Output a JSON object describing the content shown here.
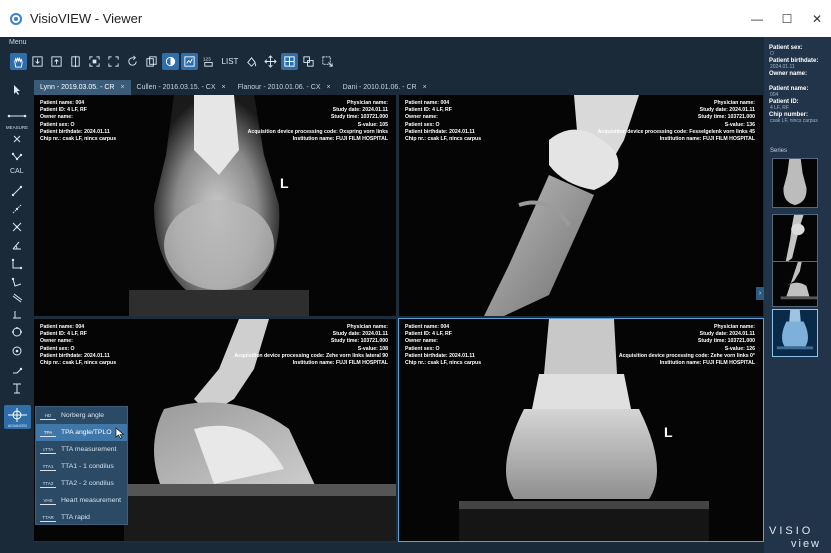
{
  "window": {
    "title": "VisioVIEW - Viewer",
    "minimize": "—",
    "maximize": "☐",
    "close": "✕"
  },
  "menu_label": "Menu",
  "toolbar": {
    "list_label": "LIST"
  },
  "left_tools": {
    "measure_label": "MEASURE",
    "cal_label": "CAL",
    "advanced_label": "ADVANCED"
  },
  "tabs": [
    {
      "label": "Lynn - 2019.03.05. - CR",
      "close": "×"
    },
    {
      "label": "Cullen - 2016.03.15. - CX",
      "close": "×"
    },
    {
      "label": "Flanour - 2010.01.06. - CX",
      "close": "×"
    },
    {
      "label": "Dani - 2010.01.06. - CR",
      "close": "×"
    }
  ],
  "viewports": [
    {
      "left": [
        "Patient name: 004",
        "Patient ID: 4 LF, RF",
        "Owner name:",
        "Patient sex: O",
        "Patient birthdate: 2024.01.11",
        "Chip nr.: csak LF, nincs carpus"
      ],
      "right": [
        "Physician name:",
        "Study date: 2024.01.11",
        "Study time: 103721.000",
        "S-value: 105",
        "Acquisition device processing code: Oxspring vorn links",
        "Institution name: FUJI FILM HOSPITAL"
      ],
      "marker": "L"
    },
    {
      "left": [
        "Patient name: 004",
        "Patient ID: 4 LF, RF",
        "Owner name:",
        "Patient sex: O",
        "Patient birthdate: 2024.01.11",
        "Chip nr.: csak LF, nincs carpus"
      ],
      "right": [
        "Physician name:",
        "Study date: 2024.01.11",
        "Study time: 103721.000",
        "S-value: 136",
        "Acquisition device processing code: Fesselgelenk vorn links 45",
        "Institution name: FUJI FILM HOSPITAL"
      ],
      "marker": ""
    },
    {
      "left": [
        "Patient name: 004",
        "Patient ID: 4 LF, RF",
        "Owner name:",
        "Patient sex: O",
        "Patient birthdate: 2024.01.11",
        "Chip nr.: csak LF, nincs carpus"
      ],
      "right": [
        "Physician name:",
        "Study date: 2024.01.11",
        "Study time: 103721.000",
        "S-value: 108",
        "Acquisition device processing code: Zehe vorn links lateral 90",
        "Institution name: FUJI FILM HOSPITAL"
      ],
      "marker": ""
    },
    {
      "left": [
        "Patient name: 004",
        "Patient ID: 4 LF, RF",
        "Owner name:",
        "Patient sex: O",
        "Patient birthdate: 2024.01.11",
        "Chip nr.: csak LF, nincs carpus"
      ],
      "right": [
        "Physician name:",
        "Study date: 2024.01.11",
        "Study time: 103721.000",
        "S-value: 126",
        "Acquisition device processing code: Zehe vorn links 0°",
        "Institution name: FUJI FILM HOSPITAL"
      ],
      "marker": "L"
    }
  ],
  "dropdown": [
    {
      "code": "HD",
      "label": "Norberg angle"
    },
    {
      "code": "TPA",
      "label": "TPA angle/TPLO"
    },
    {
      "code": "cTTA",
      "label": "TTA measurement"
    },
    {
      "code": "TTA1",
      "label": "TTA1 - 1 condilus"
    },
    {
      "code": "TTA2",
      "label": "TTA2 - 2 condilus"
    },
    {
      "code": "VHS",
      "label": "Heart measurement"
    },
    {
      "code": "TTAR",
      "label": "TTA rapid"
    }
  ],
  "right_panel": {
    "fields": [
      {
        "label": "Patient sex:",
        "value": "O"
      },
      {
        "label": "Patient birthdate:",
        "value": "2024.01.11"
      },
      {
        "label": "Owner name:",
        "value": ""
      },
      {
        "label": "Patient name:",
        "value": "004"
      },
      {
        "label": "Patient ID:",
        "value": "4 LF, RF"
      },
      {
        "label": "Chip number:",
        "value": "csak LF, nincs carpus"
      }
    ],
    "series_label": "Series"
  },
  "brand": {
    "line1": "VISIO",
    "line2": "view"
  }
}
